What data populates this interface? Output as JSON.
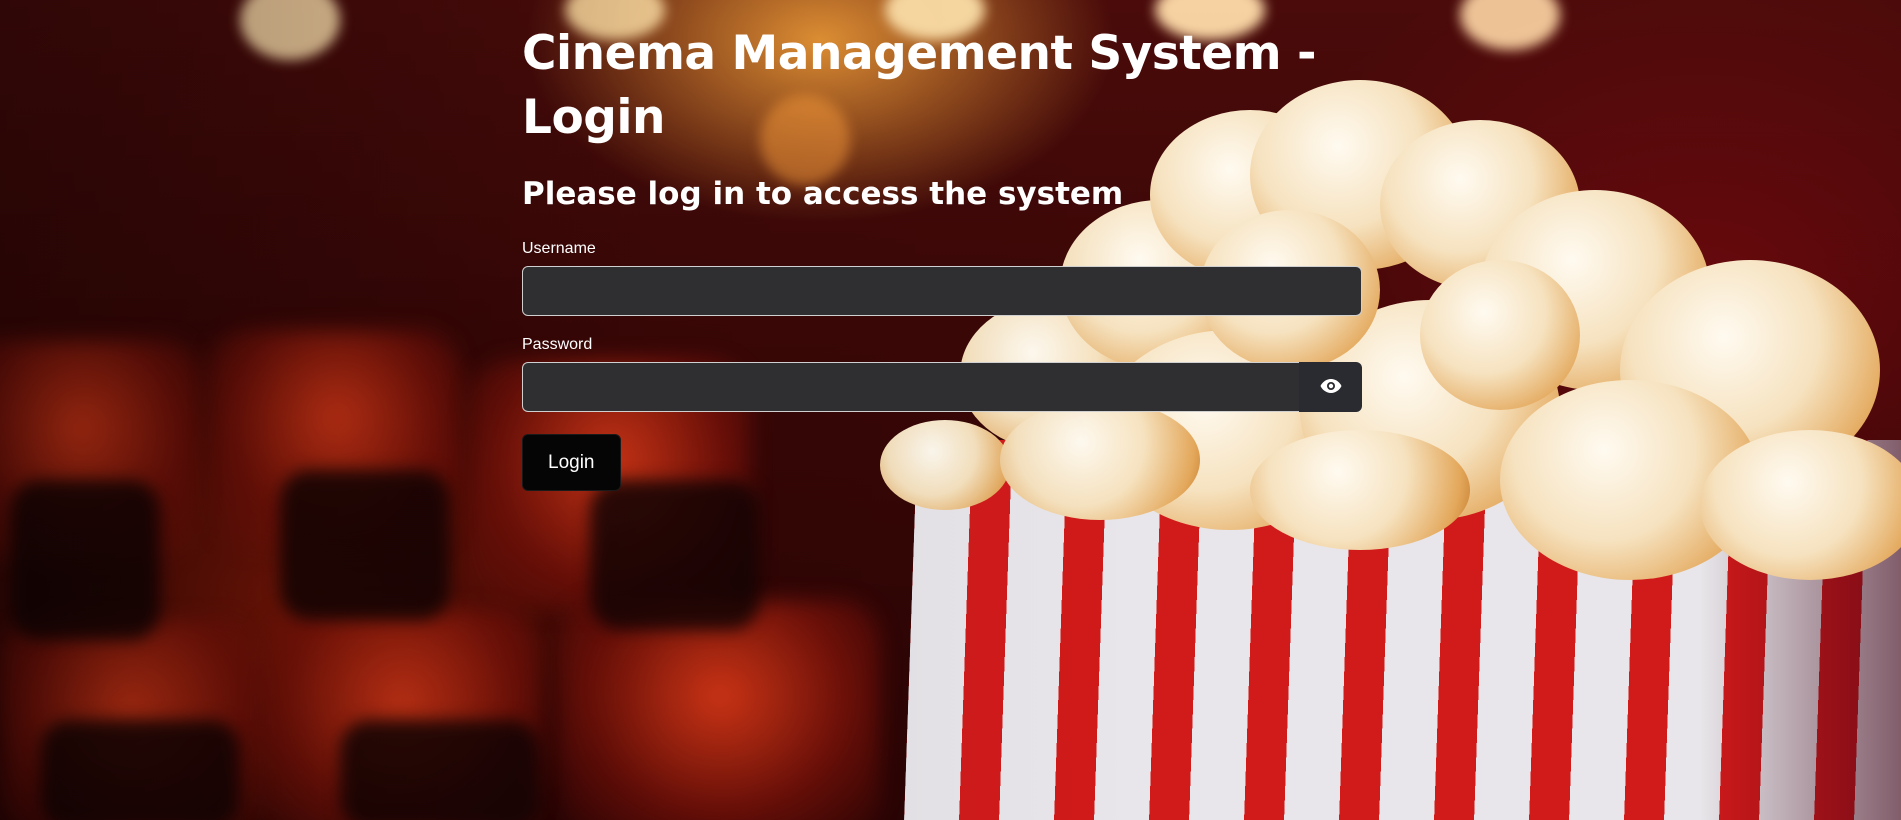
{
  "page": {
    "title": "Cinema Management System - Login",
    "subtitle": "Please log in to access the system"
  },
  "form": {
    "username": {
      "label": "Username",
      "value": "",
      "placeholder": ""
    },
    "password": {
      "label": "Password",
      "value": "",
      "placeholder": ""
    },
    "toggle_icon": "eye-icon",
    "login_label": "Login"
  },
  "theme": {
    "input_bg": "#2f2f31",
    "button_bg": "#050505",
    "text": "#ffffff"
  }
}
